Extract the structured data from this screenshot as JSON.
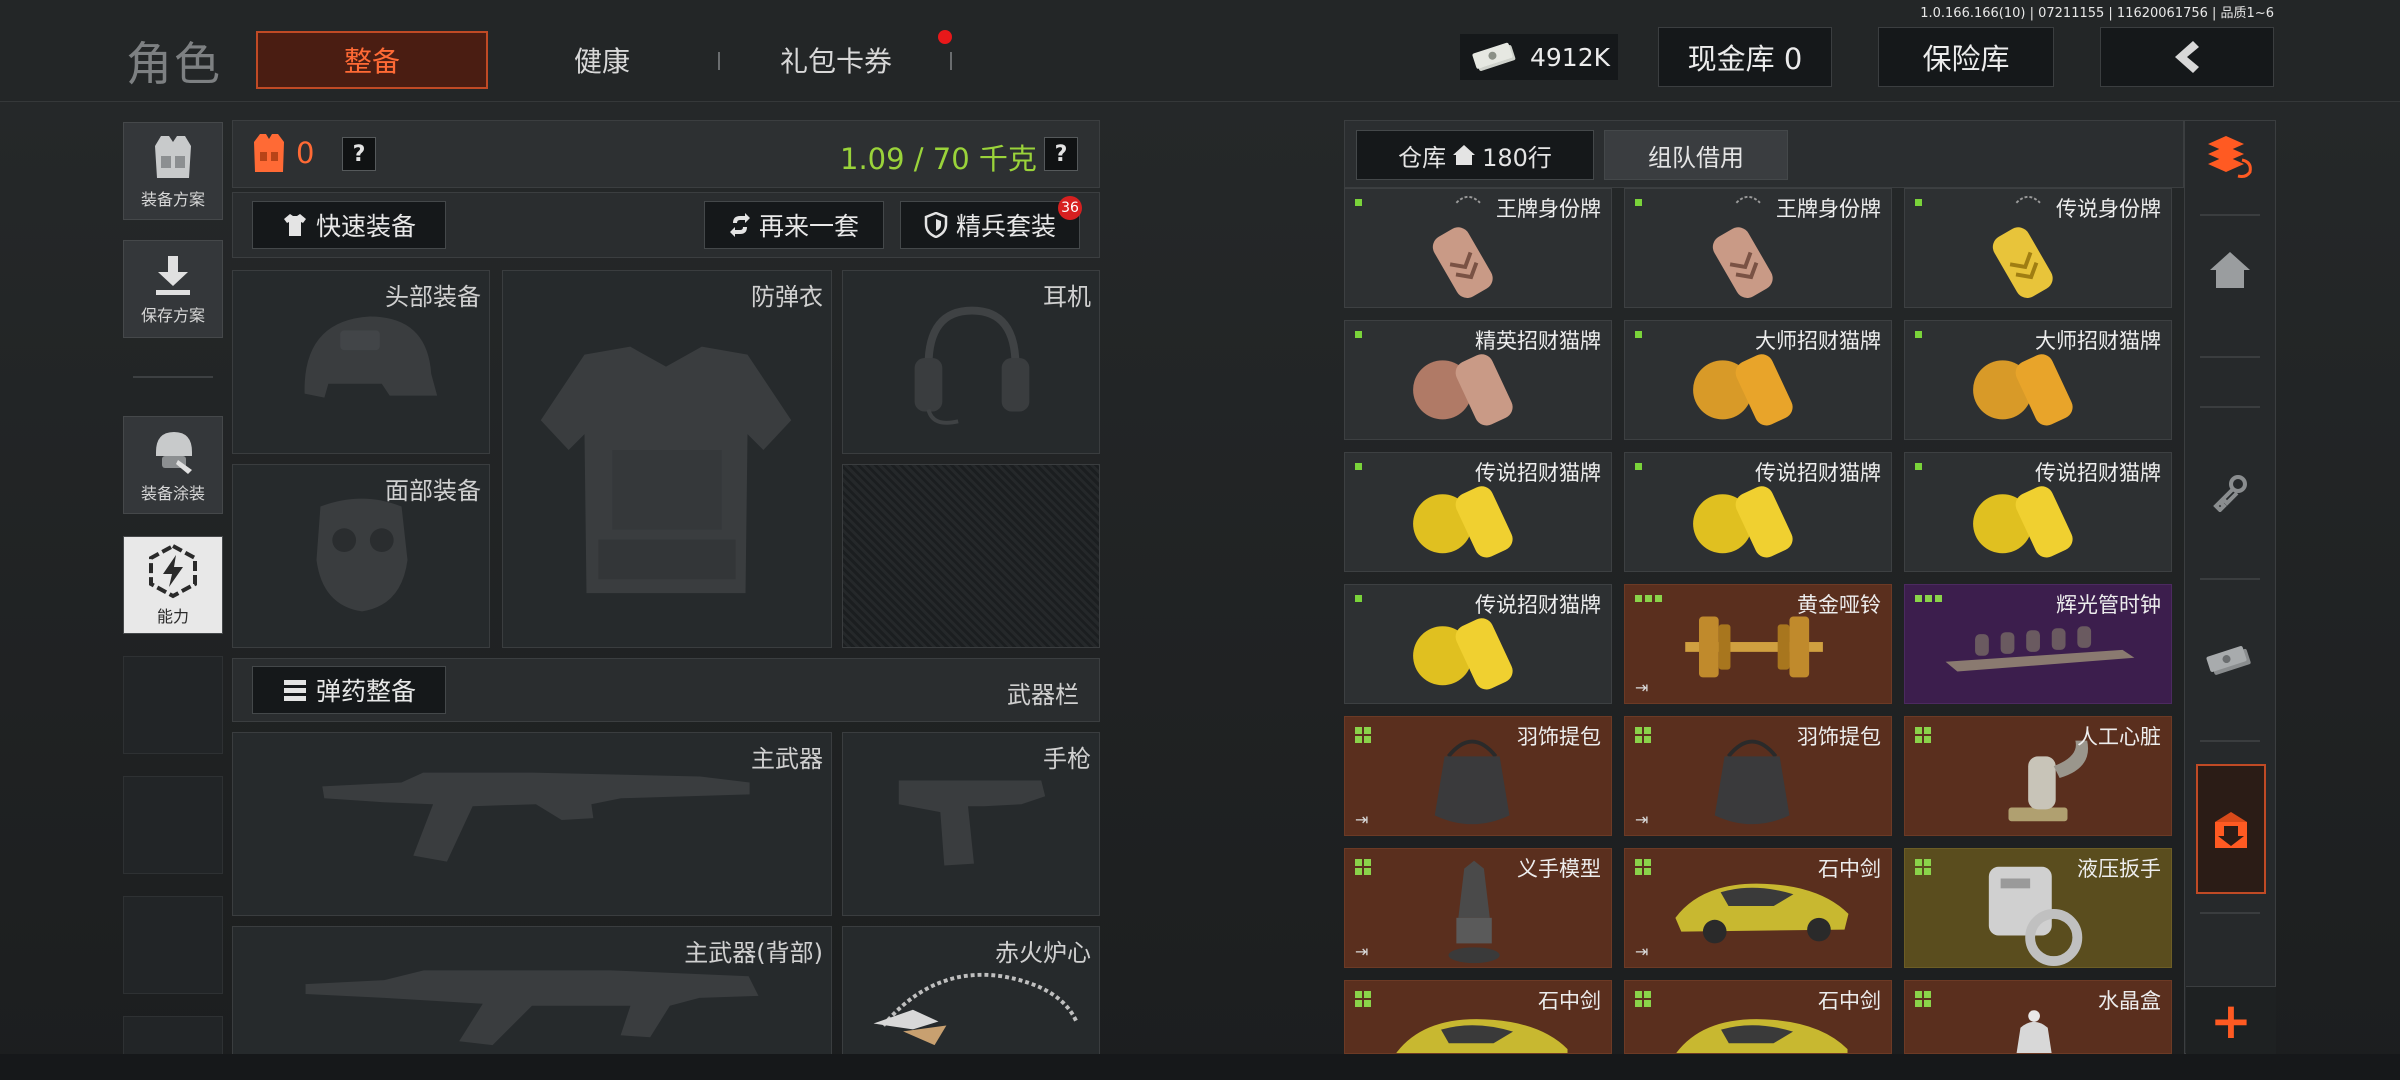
{
  "version_text": "1.0.166.166(10) | 07211155 | 11620061756 | 品质1~6",
  "header": {
    "title": "角色",
    "tabs": [
      {
        "label": "整备",
        "active": true
      },
      {
        "label": "健康",
        "active": false
      },
      {
        "label": "礼包卡券",
        "active": false,
        "has_notification": true
      }
    ],
    "currency_amount": "4912K",
    "cash_vault_label": "现金库 0",
    "safe_box_label": "保险库",
    "back_icon": "chevron-left-icon"
  },
  "sidebar": {
    "items": [
      {
        "label": "装备方案",
        "icon": "vest-icon"
      },
      {
        "label": "保存方案",
        "icon": "download-icon"
      },
      {
        "label": "装备涂装",
        "icon": "helmet-paint-icon"
      },
      {
        "label": "能力",
        "icon": "lightning-hex-icon",
        "active": true
      }
    ]
  },
  "equipment": {
    "armor_count": "0",
    "help_symbol": "?",
    "weight": "1.09 / 70 千克",
    "quick_equip_label": "快速装备",
    "repeat_label": "再来一套",
    "elite_set_label": "精兵套装",
    "elite_set_badge": "36",
    "slots": {
      "head": "头部装备",
      "armor": "防弹衣",
      "headset": "耳机",
      "face": "面部装备"
    },
    "ammo_label": "弹药整备",
    "weapon_bar_label": "武器栏",
    "weapons": {
      "primary": "主武器",
      "pistol": "手枪",
      "primary_back": "主武器(背部)",
      "melee": "赤火炉心"
    }
  },
  "warehouse": {
    "tab_storage": "仓库",
    "tab_storage_rows": "180行",
    "tab_team": "组队借用",
    "items": [
      {
        "name": "王牌身份牌",
        "rarity": "gray"
      },
      {
        "name": "王牌身份牌",
        "rarity": "gray"
      },
      {
        "name": "传说身份牌",
        "rarity": "gray"
      },
      {
        "name": "精英招财猫牌",
        "rarity": "gray"
      },
      {
        "name": "大师招财猫牌",
        "rarity": "gray"
      },
      {
        "name": "大师招财猫牌",
        "rarity": "gray"
      },
      {
        "name": "传说招财猫牌",
        "rarity": "gray"
      },
      {
        "name": "传说招财猫牌",
        "rarity": "gray"
      },
      {
        "name": "传说招财猫牌",
        "rarity": "gray"
      },
      {
        "name": "传说招财猫牌",
        "rarity": "gray"
      },
      {
        "name": "黄金哑铃",
        "rarity": "brown"
      },
      {
        "name": "辉光管时钟",
        "rarity": "purple"
      },
      {
        "name": "羽饰提包",
        "rarity": "brown"
      },
      {
        "name": "羽饰提包",
        "rarity": "brown"
      },
      {
        "name": "人工心脏",
        "rarity": "brown"
      },
      {
        "name": "义手模型",
        "rarity": "brown"
      },
      {
        "name": "石中剑",
        "rarity": "brown"
      },
      {
        "name": "液压扳手",
        "rarity": "gold"
      },
      {
        "name": "石中剑",
        "rarity": "brown"
      },
      {
        "name": "石中剑",
        "rarity": "brown"
      },
      {
        "name": "水晶盒",
        "rarity": "brown"
      }
    ]
  },
  "rail": {
    "icons": [
      "stack-refresh-icon",
      "home-icon",
      "key-icon",
      "cash-icon",
      "box-download-icon"
    ],
    "plus_symbol": "+"
  },
  "colors": {
    "accent": "#ff6a35",
    "weight_ok": "#9ad33a",
    "notification": "#e8181a"
  }
}
